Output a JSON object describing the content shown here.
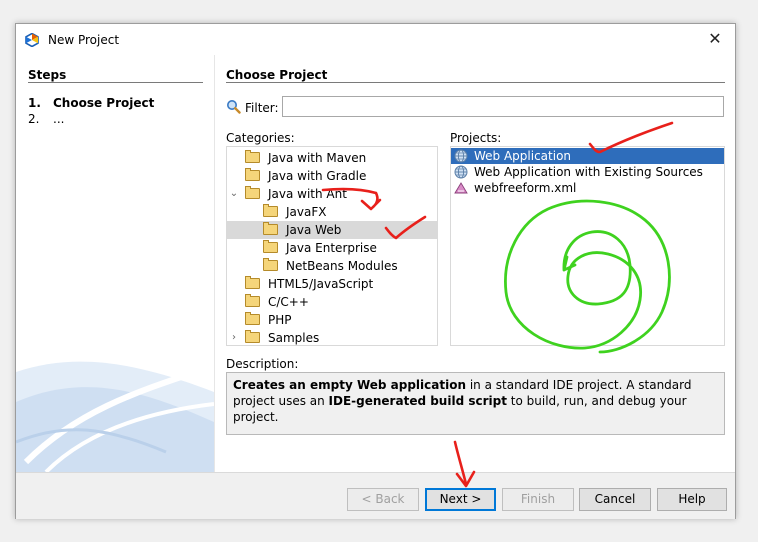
{
  "window": {
    "title": "New Project",
    "close_glyph": "✕"
  },
  "steps": {
    "title": "Steps",
    "items": [
      {
        "num": "1.",
        "label": "Choose Project"
      },
      {
        "num": "2.",
        "label": "..."
      }
    ]
  },
  "main": {
    "title": "Choose Project",
    "filter": {
      "label": "Filter:",
      "value": "",
      "placeholder": ""
    },
    "categories_label": "Categories:",
    "categories": [
      {
        "label": "Java with Maven"
      },
      {
        "label": "Java with Gradle"
      },
      {
        "label": "Java with Ant",
        "expanded": true
      },
      {
        "label": "JavaFX"
      },
      {
        "label": "Java Web",
        "selected": true
      },
      {
        "label": "Java Enterprise"
      },
      {
        "label": "NetBeans Modules"
      },
      {
        "label": "HTML5/JavaScript"
      },
      {
        "label": "C/C++"
      },
      {
        "label": "PHP"
      },
      {
        "label": "Samples",
        "expandable": true
      }
    ],
    "projects_label": "Projects:",
    "projects": [
      {
        "label": "Web Application",
        "icon": "globe-icon",
        "selected": true
      },
      {
        "label": "Web Application with Existing Sources",
        "icon": "globe-icon"
      },
      {
        "label": "webfreeform.xml",
        "icon": "xml-file-icon"
      }
    ],
    "description_label": "Description:",
    "description": {
      "bold1": "Creates an empty Web application",
      "text1": " in a standard IDE project. A standard project uses an ",
      "bold2": "IDE-generated build script",
      "text2": " to build, run, and debug your project."
    }
  },
  "buttons": {
    "back": "< Back",
    "next": "Next >",
    "finish": "Finish",
    "cancel": "Cancel",
    "help": "Help"
  },
  "colors": {
    "selection_blue": "#2e6dbb",
    "annotation_red": "#e8201b",
    "annotation_green": "#3fd21f"
  }
}
